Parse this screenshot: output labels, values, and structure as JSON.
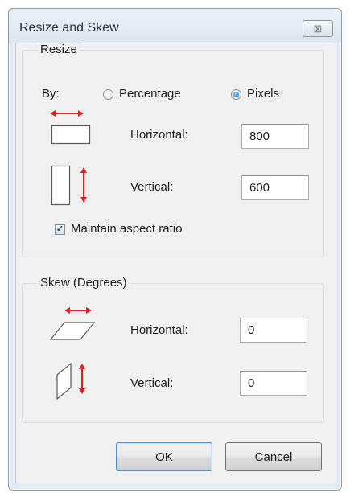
{
  "dialog": {
    "title": "Resize and Skew",
    "close_glyph": "⊠"
  },
  "resize": {
    "group_label": "Resize",
    "by_label": "By:",
    "options": {
      "percentage": "Percentage",
      "pixels": "Pixels"
    },
    "selected_option": "Pixels",
    "horizontal_label": "Horizontal:",
    "horizontal_value": "800",
    "vertical_label": "Vertical:",
    "vertical_value": "600",
    "maintain_aspect_label": "Maintain aspect ratio",
    "maintain_aspect_checked": true
  },
  "skew": {
    "group_label": "Skew (Degrees)",
    "horizontal_label": "Horizontal:",
    "horizontal_value": "0",
    "vertical_label": "Vertical:",
    "vertical_value": "0"
  },
  "buttons": {
    "ok": "OK",
    "cancel": "Cancel"
  },
  "colors": {
    "arrow": "#e02020",
    "accent": "#1f6fbf"
  }
}
